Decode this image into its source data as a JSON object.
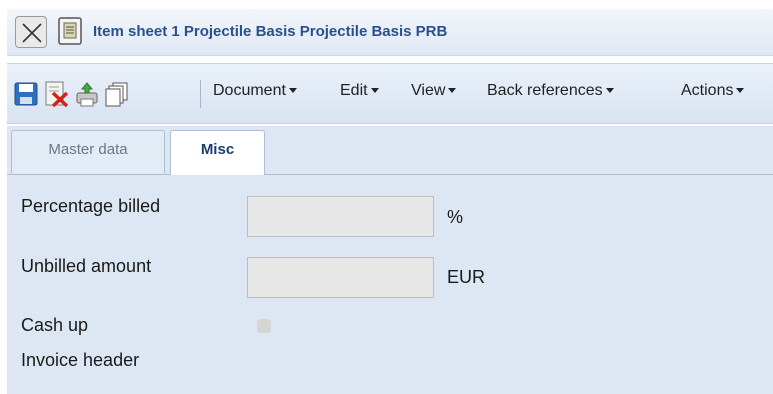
{
  "window": {
    "title": "Item sheet 1 Projectile Basis Projectile Basis PRB",
    "close_icon": "close-icon",
    "document_icon": "document-icon"
  },
  "toolbar": {
    "icons": [
      "save-icon",
      "delete-icon",
      "print-icon",
      "copy-icon"
    ],
    "menus": [
      "Document",
      "Edit",
      "View",
      "Back references",
      "Actions"
    ]
  },
  "tabs": [
    {
      "label": "Master data",
      "active": false
    },
    {
      "label": "Misc",
      "active": true
    }
  ],
  "form": {
    "percentage_billed": {
      "label": "Percentage billed",
      "value": "",
      "unit": "%"
    },
    "unbilled_amount": {
      "label": "Unbilled amount",
      "value": "",
      "unit": "EUR"
    },
    "cash_up": {
      "label": "Cash up",
      "checked": false
    },
    "invoice_header": {
      "label": "Invoice header"
    }
  }
}
